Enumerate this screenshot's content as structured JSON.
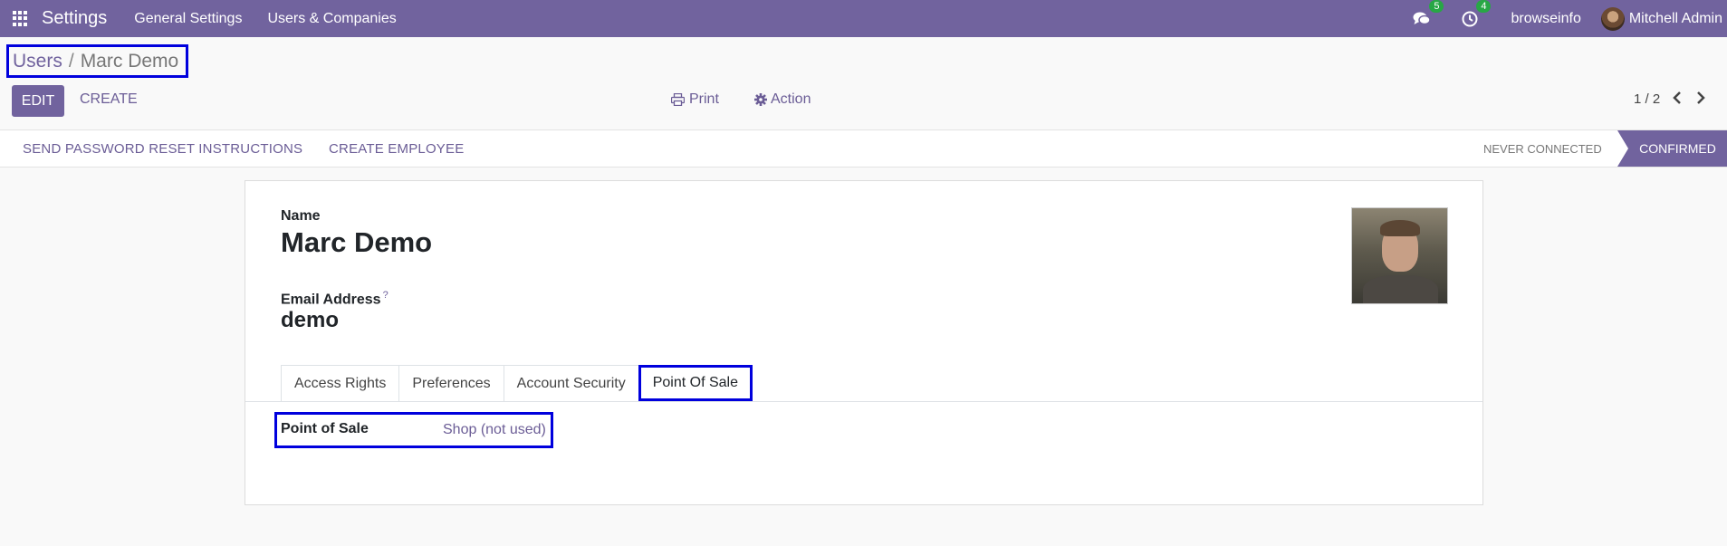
{
  "navbar": {
    "brand": "Settings",
    "menus": [
      "General Settings",
      "Users & Companies"
    ],
    "messages_count": "5",
    "activities_count": "4",
    "company": "browseinfo",
    "user": "Mitchell Admin",
    "color": "#71639e"
  },
  "breadcrumb": {
    "parent": "Users",
    "separator": "/",
    "current": "Marc Demo"
  },
  "controls": {
    "edit": "EDIT",
    "create": "CREATE",
    "print": "Print",
    "action": "Action",
    "pager": "1 / 2"
  },
  "statusbar": {
    "buttons": [
      "SEND PASSWORD RESET INSTRUCTIONS",
      "CREATE EMPLOYEE"
    ],
    "stages": [
      "NEVER CONNECTED",
      "CONFIRMED"
    ],
    "active_stage": "CONFIRMED"
  },
  "form": {
    "name_label": "Name",
    "name_value": "Marc Demo",
    "email_label": "Email Address",
    "email_help": "?",
    "email_value": "demo",
    "tabs": [
      "Access Rights",
      "Preferences",
      "Account Security",
      "Point Of Sale"
    ],
    "active_tab": "Point Of Sale",
    "pos_label": "Point of Sale",
    "pos_value": "Shop (not used)"
  }
}
